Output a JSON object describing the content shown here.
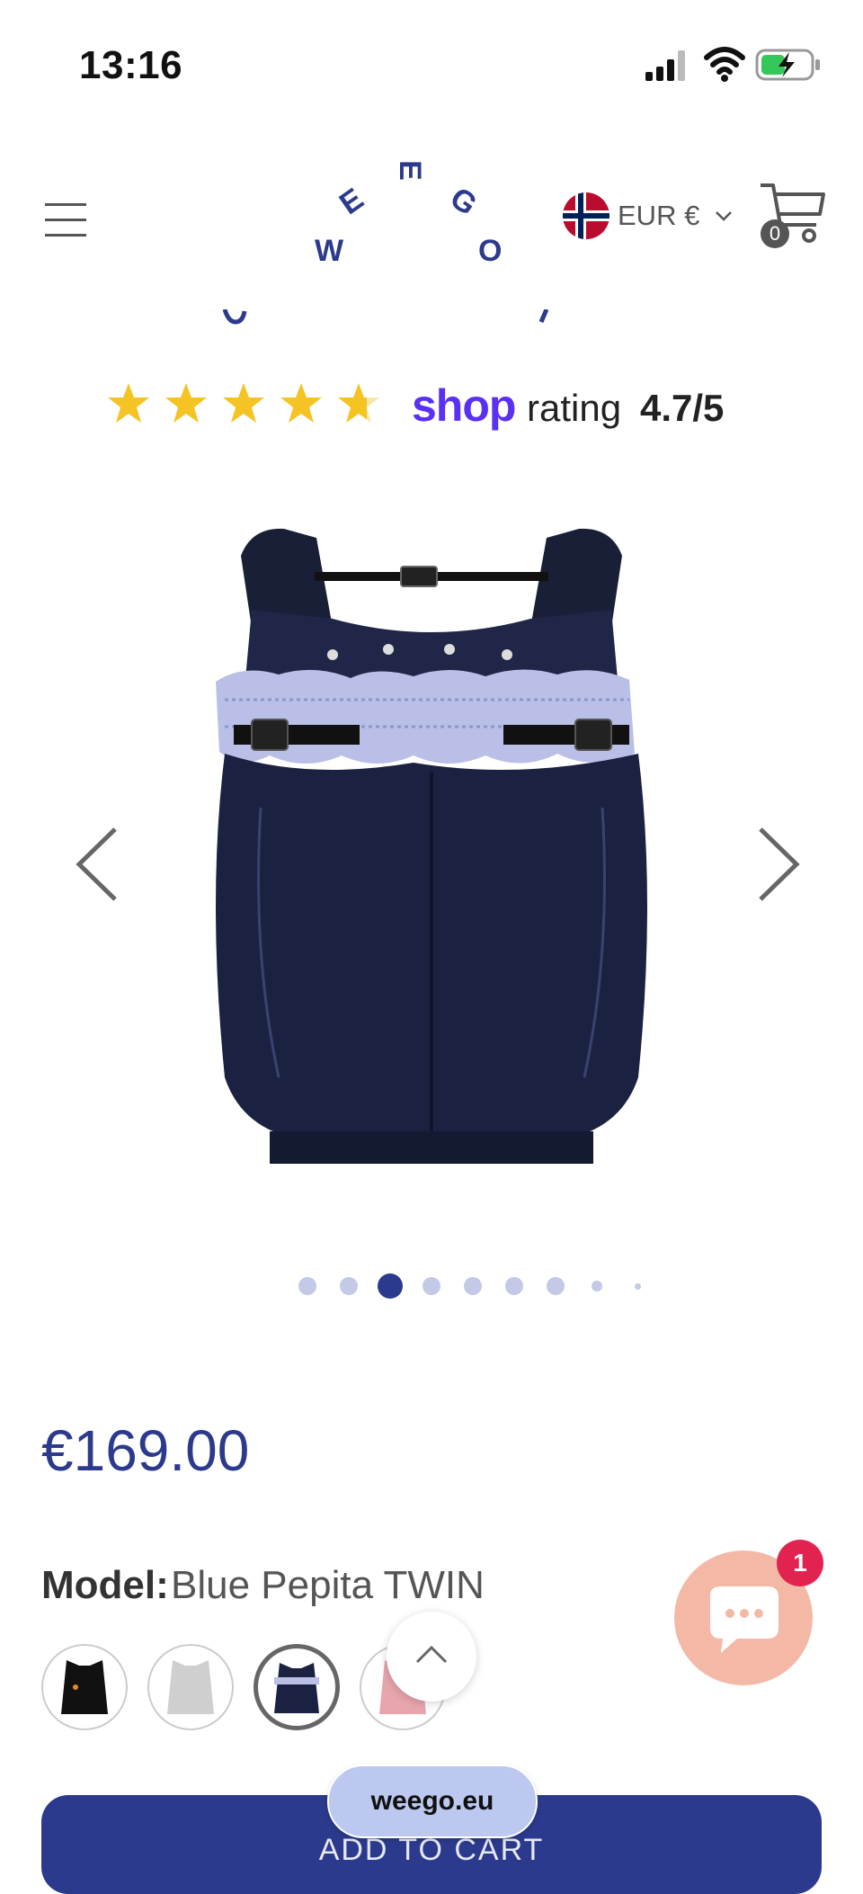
{
  "status_bar": {
    "time": "13:16"
  },
  "header": {
    "logo_letters": [
      "W",
      "E",
      "E",
      "G",
      "O"
    ],
    "currency": "EUR €",
    "cart_count": "0"
  },
  "rating": {
    "shop_word": "shop",
    "rating_word": "rating",
    "value": "4.7/5",
    "stars": 4.7
  },
  "gallery": {
    "dots_count": 9,
    "active_dot": 3
  },
  "product": {
    "price": "€169.00",
    "model_label": "Model:",
    "model_value": "Blue Pepita TWIN"
  },
  "chat": {
    "badge_count": "1"
  },
  "browser": {
    "url": "weego.eu"
  },
  "cta": {
    "add_to_cart": "ADD TO CART"
  },
  "colors": {
    "brand": "#2b3a8c",
    "shop_purple": "#5a31f4",
    "chat_bubble": "#f3b9a6",
    "badge": "#e3234f"
  }
}
